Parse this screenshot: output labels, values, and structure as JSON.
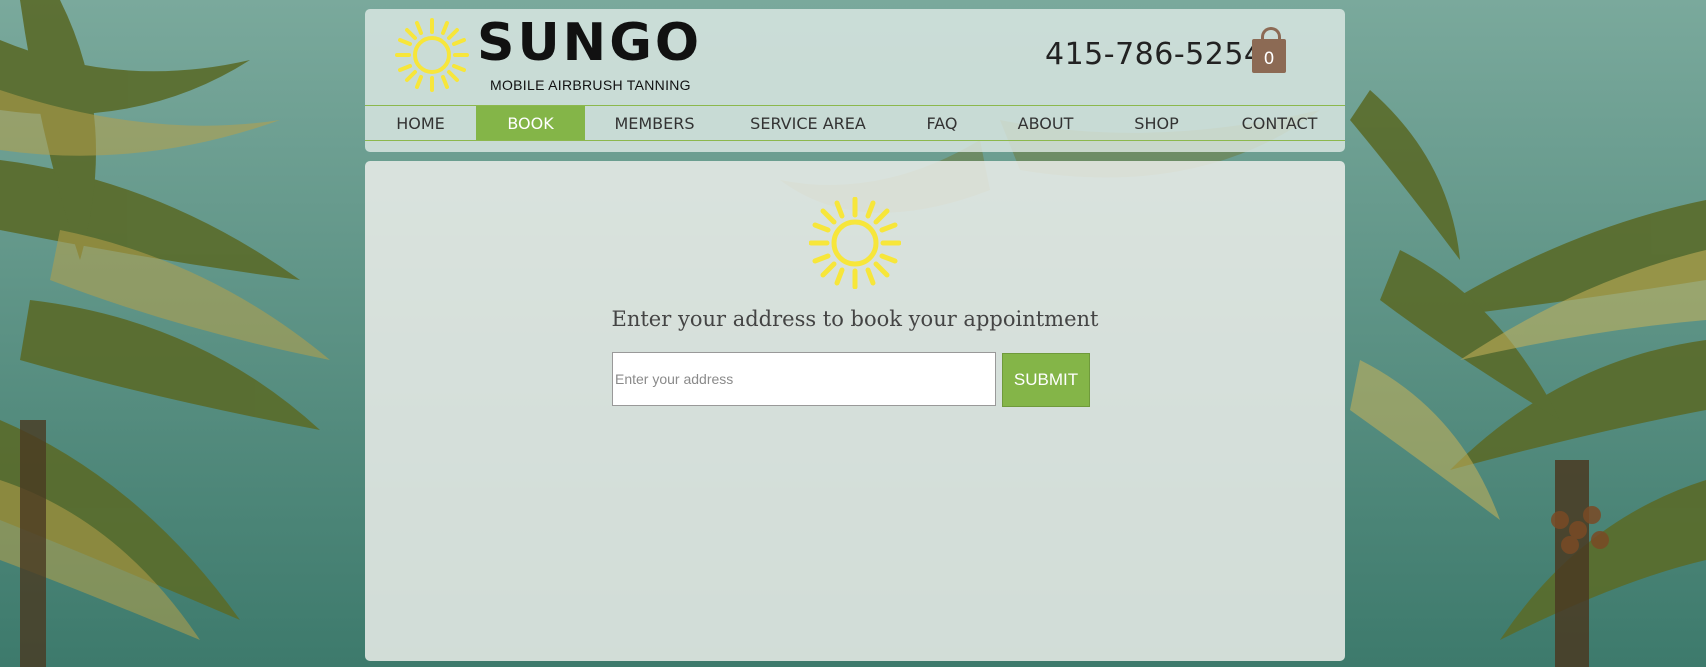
{
  "brand": {
    "name": "SUNGO",
    "tagline": "MOBILE AIRBRUSH TANNING",
    "sun_color": "#f7e63a"
  },
  "header": {
    "phone": "415-786-5254",
    "cart_count": "0",
    "cart_icon": "shopping-bag-icon"
  },
  "nav": {
    "items": [
      {
        "label": "HOME"
      },
      {
        "label": "BOOK",
        "active": true
      },
      {
        "label": "MEMBERS"
      },
      {
        "label": "SERVICE AREA"
      },
      {
        "label": "FAQ"
      },
      {
        "label": "ABOUT"
      },
      {
        "label": "SHOP"
      },
      {
        "label": "CONTACT"
      }
    ]
  },
  "booking": {
    "prompt": "Enter your address to book your appointment",
    "address_placeholder": "Enter your address",
    "address_value": "",
    "submit_label": "SUBMIT"
  },
  "colors": {
    "accent_green": "#84b548",
    "cart_brown": "#8c6a54"
  }
}
